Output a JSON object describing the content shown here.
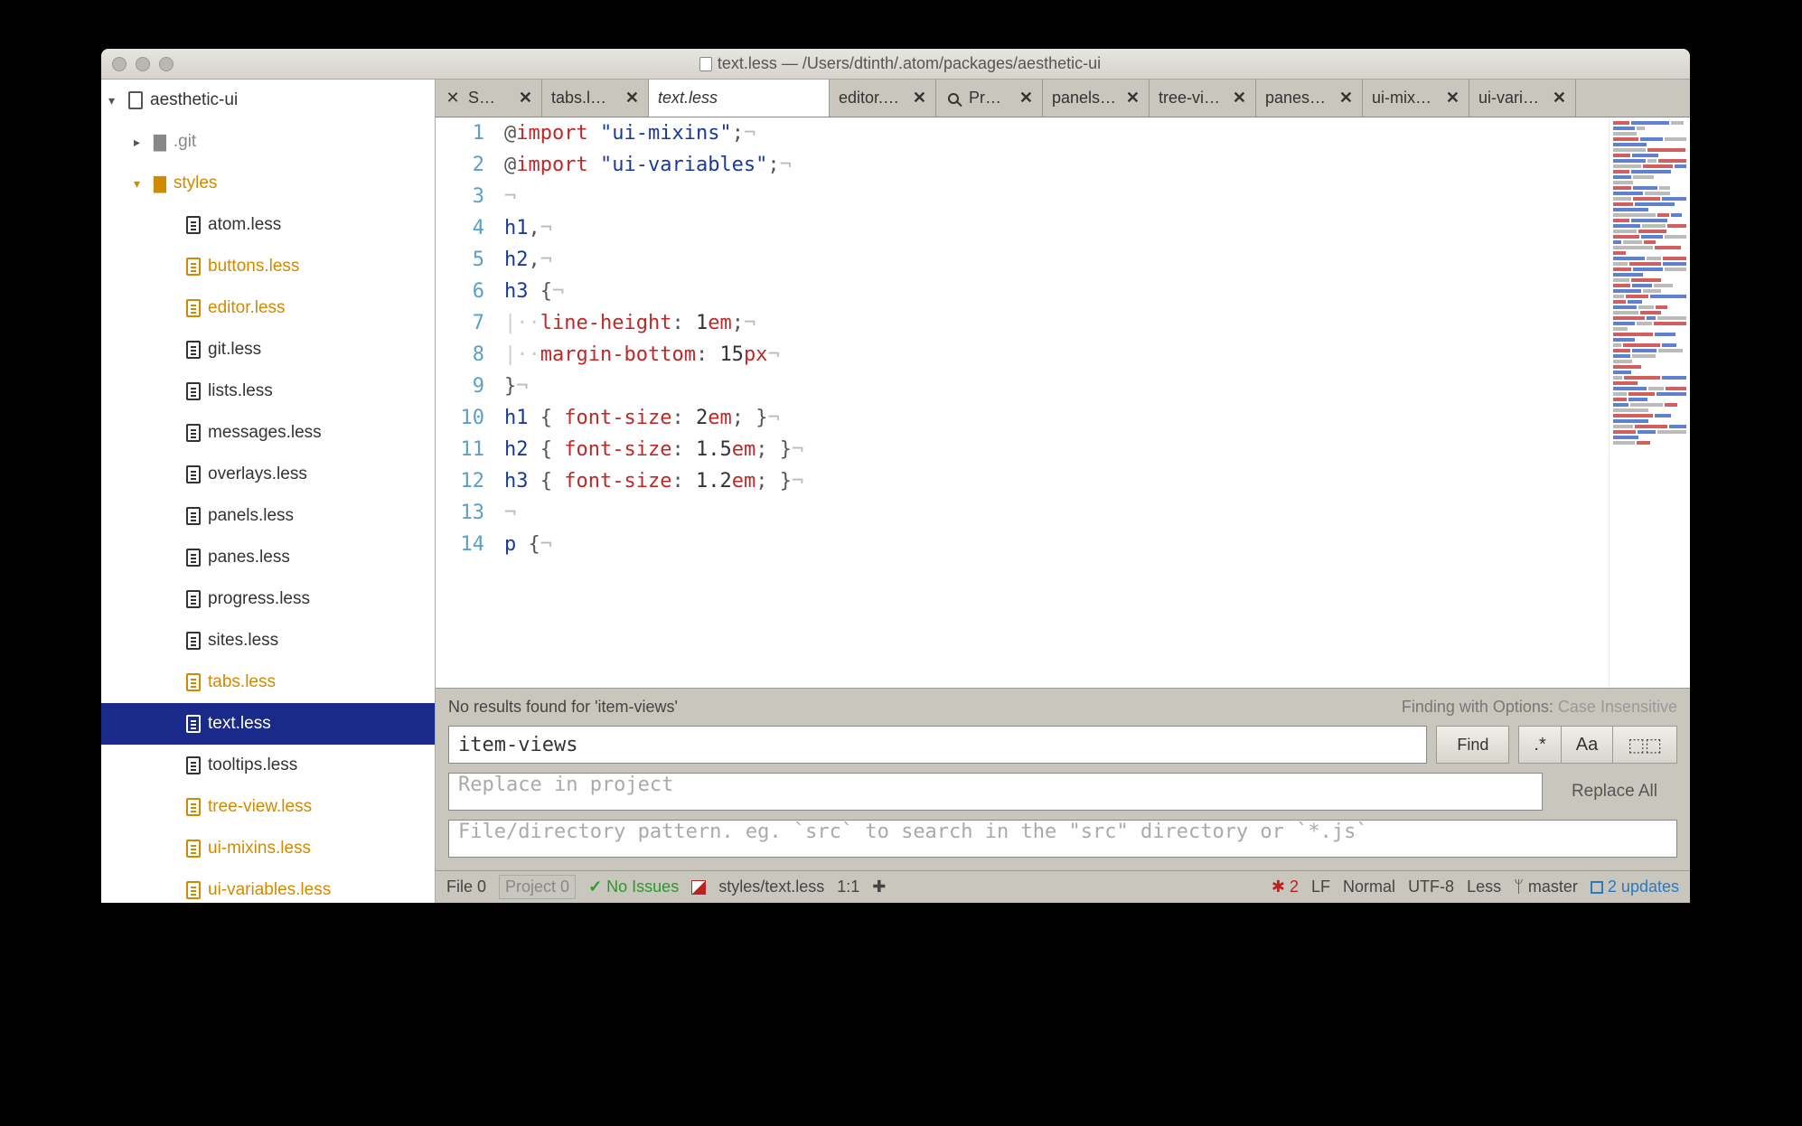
{
  "window": {
    "title": "text.less — /Users/dtinth/.atom/packages/aesthetic-ui"
  },
  "tree": {
    "root": "aesthetic-ui",
    "git_folder": ".git",
    "styles_folder": "styles",
    "files": [
      {
        "name": "atom.less",
        "modified": false
      },
      {
        "name": "buttons.less",
        "modified": true
      },
      {
        "name": "editor.less",
        "modified": true
      },
      {
        "name": "git.less",
        "modified": false
      },
      {
        "name": "lists.less",
        "modified": false
      },
      {
        "name": "messages.less",
        "modified": false
      },
      {
        "name": "overlays.less",
        "modified": false
      },
      {
        "name": "panels.less",
        "modified": false
      },
      {
        "name": "panes.less",
        "modified": false
      },
      {
        "name": "progress.less",
        "modified": false
      },
      {
        "name": "sites.less",
        "modified": false
      },
      {
        "name": "tabs.less",
        "modified": true
      },
      {
        "name": "text.less",
        "modified": false,
        "selected": true
      },
      {
        "name": "tooltips.less",
        "modified": false
      },
      {
        "name": "tree-view.less",
        "modified": true
      },
      {
        "name": "ui-mixins.less",
        "modified": true
      },
      {
        "name": "ui-variables.less",
        "modified": true
      }
    ]
  },
  "tabs": [
    {
      "label": "S…",
      "icon": "settings"
    },
    {
      "label": "tabs.l…"
    },
    {
      "label": "text.less",
      "active": true,
      "no_close": true
    },
    {
      "label": "editor.…"
    },
    {
      "label": "Pr…",
      "icon": "search"
    },
    {
      "label": "panels…"
    },
    {
      "label": "tree-vi…"
    },
    {
      "label": "panes…"
    },
    {
      "label": "ui-mix…"
    },
    {
      "label": "ui-vari…"
    }
  ],
  "editor": {
    "lines": [
      {
        "n": 1,
        "t": "import",
        "arg": "ui-mixins"
      },
      {
        "n": 2,
        "t": "import",
        "arg": "ui-variables"
      },
      {
        "n": 3,
        "t": "blank"
      },
      {
        "n": 4,
        "t": "tagc",
        "tag": "h1"
      },
      {
        "n": 5,
        "t": "tagc",
        "tag": "h2"
      },
      {
        "n": 6,
        "t": "tago",
        "tag": "h3"
      },
      {
        "n": 7,
        "t": "prop",
        "name": "line-height",
        "val": "1",
        "unit": "em",
        "semi": true
      },
      {
        "n": 8,
        "t": "prop",
        "name": "margin-bottom",
        "val": "15",
        "unit": "px",
        "semi": false
      },
      {
        "n": 9,
        "t": "close"
      },
      {
        "n": 10,
        "t": "rule1",
        "tag": "h1",
        "prop": "font-size",
        "val": "2",
        "unit": "em"
      },
      {
        "n": 11,
        "t": "rule1",
        "tag": "h2",
        "prop": "font-size",
        "val": "1.5",
        "unit": "em"
      },
      {
        "n": 12,
        "t": "rule1",
        "tag": "h3",
        "prop": "font-size",
        "val": "1.2",
        "unit": "em"
      },
      {
        "n": 13,
        "t": "blank"
      },
      {
        "n": 14,
        "t": "tago",
        "tag": "p"
      }
    ]
  },
  "find": {
    "status_left": "No results found for 'item-views'",
    "status_right_prefix": "Finding with Options: ",
    "status_right_opt": "Case Insensitive",
    "query": "item-views",
    "replace_placeholder": "Replace in project",
    "path_placeholder": "File/directory pattern. eg. `src` to search in the \"src\" directory or `*.js`",
    "find_btn": "Find",
    "regex_label": ".*",
    "case_label": "Aa",
    "replace_all": "Replace All"
  },
  "status": {
    "file": "File  0",
    "project": "Project  0",
    "issues": "No Issues",
    "path": "styles/text.less",
    "cursor": "1:1",
    "errors": "2",
    "eol": "LF",
    "ws": "Normal",
    "enc": "UTF-8",
    "lang": "Less",
    "branch": "master",
    "updates": "2 updates"
  }
}
